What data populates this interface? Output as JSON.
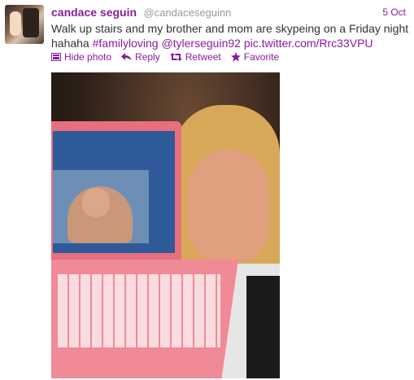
{
  "tweet": {
    "author_name": "candace seguin",
    "author_handle": "@candaceseguinn",
    "date": "5 Oct",
    "text_plain": "Walk up stairs and my brother and mom are skypeing on a Friday night hahaha ",
    "hashtag": "#familyloving",
    "mention": "@tylerseguin92",
    "link": "pic.twitter.com/Rrc33VPU",
    "actions": {
      "hide_photo": "Hide photo",
      "reply": "Reply",
      "retweet": "Retweet",
      "favorite": "Favorite"
    }
  },
  "colors": {
    "accent": "#8a1b9e",
    "handle": "#999999",
    "text": "#333333"
  },
  "icons": [
    "photo-icon",
    "reply-icon",
    "retweet-icon",
    "favorite-icon"
  ]
}
